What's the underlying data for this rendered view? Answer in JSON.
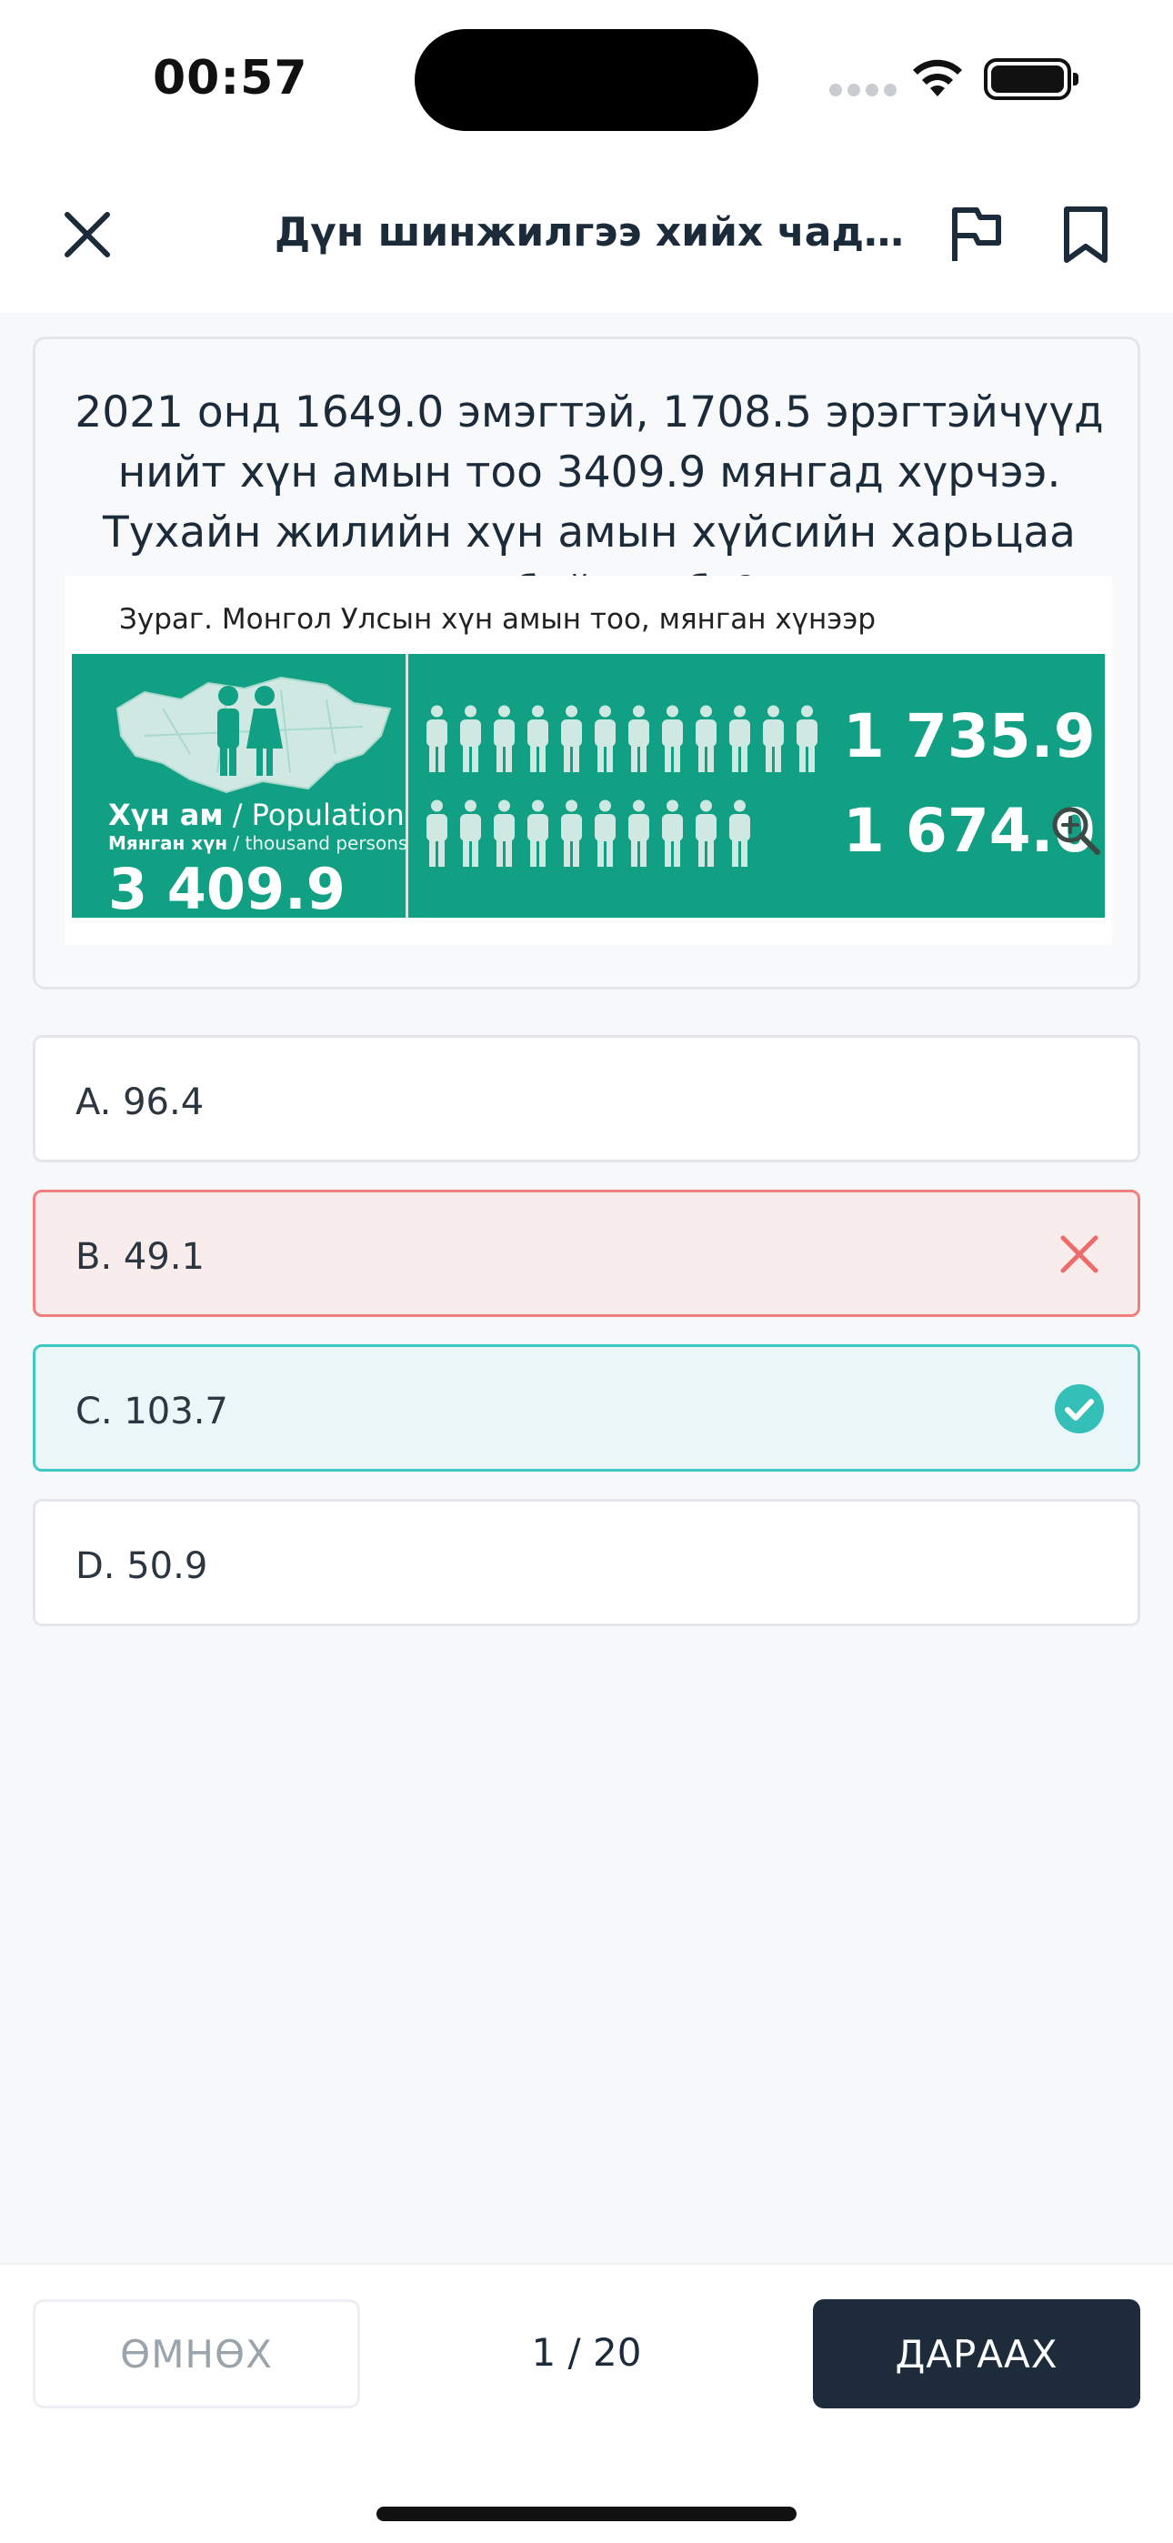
{
  "status_bar": {
    "time": "00:57"
  },
  "header": {
    "title": "Дүн шинжилгээ хийх чадварыг ш..."
  },
  "question": {
    "text": "2021 онд 1649.0 эмэгтэй, 1708.5 эрэгтэйчүүд нийт хүн амын тоо 3409.9 мянгад хүрчээ. Тухайн жилийн хүн амын хүйсийн харьцаа хэд байсан бэ?",
    "figure": {
      "caption": "Зураг. Монгол Улсын хүн амын тоо, мянган хүнээр",
      "population_label_bold": "Хүн ам",
      "population_label_rest": " / Population",
      "unit_label_bold": "Мянган хүн",
      "unit_label_rest": " / thousand persons",
      "total": "3 409.9",
      "stat_top": "1 735.9",
      "stat_bottom": "1 674.0",
      "accent_color": "#11a083"
    }
  },
  "answers": [
    {
      "label": "A. 96.4",
      "state": "default"
    },
    {
      "label": "B. 49.1",
      "state": "wrong",
      "icon": "close-icon",
      "color": "#ef6b6b"
    },
    {
      "label": "C. 103.7",
      "state": "correct",
      "icon": "check-circle-icon",
      "color": "#34bfb8"
    },
    {
      "label": "D. 50.9",
      "state": "default"
    }
  ],
  "footer": {
    "prev_label": "ӨМНӨХ",
    "page_indicator": "1 / 20",
    "next_label": "ДАРААХ"
  }
}
